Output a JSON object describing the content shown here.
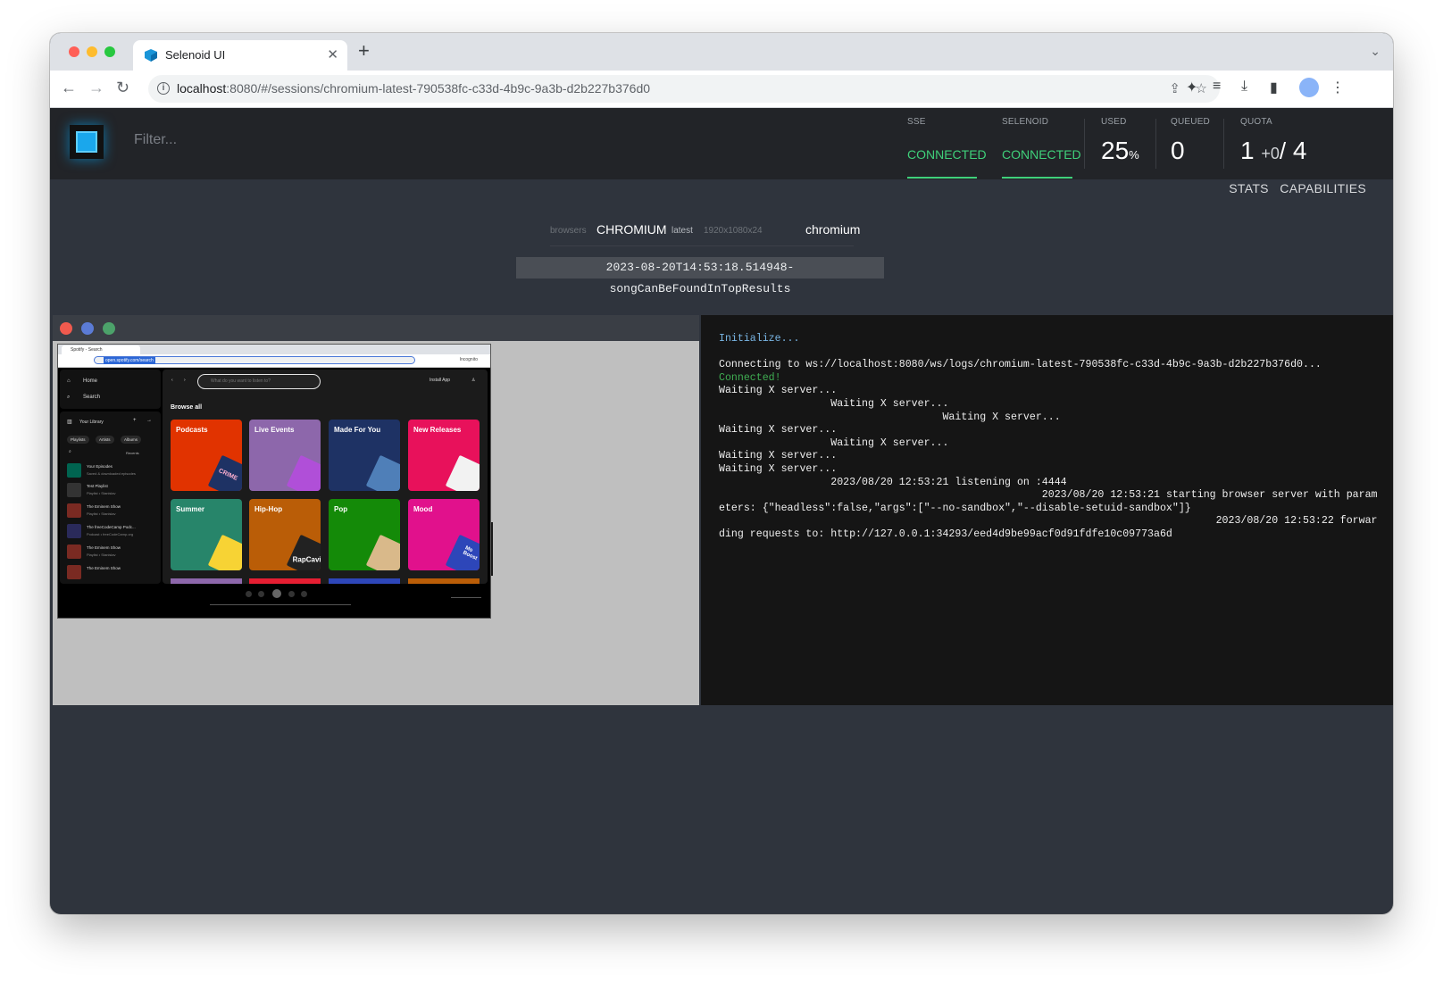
{
  "browser": {
    "tab_title": "Selenoid UI",
    "url_host": "localhost",
    "url_rest": ":8080/#/sessions/chromium-latest-790538fc-c33d-4b9c-9a3b-d2b227b376d0"
  },
  "header": {
    "filter_placeholder": "Filter...",
    "sse_label": "SSE",
    "sse_status": "CONNECTED",
    "selenoid_label": "SELENOID",
    "selenoid_status": "CONNECTED",
    "used_label": "USED",
    "used_value": "25",
    "used_unit": "%",
    "queued_label": "QUEUED",
    "queued_value": "0",
    "quota_label": "QUOTA",
    "quota_used": "1",
    "quota_plus": "+",
    "quota_queued": "0",
    "quota_slash": "/",
    "quota_total": "4"
  },
  "subnav": {
    "stats": "STATS",
    "capabilities": "CAPABILITIES"
  },
  "session": {
    "browsers_label": "browsers",
    "browser_name": "CHROMIUM",
    "version": "latest",
    "resolution": "1920x1080x24",
    "name": "chromium",
    "test_name": "2023-08-20T14:53:18.514948-songCanBeFoundInTopResults"
  },
  "vnc": {
    "tab_title": "Spotify - Search",
    "url": "open.spotify.com/search",
    "incognito": "Incognito",
    "sidebar": {
      "home": "Home",
      "search": "Search",
      "library": "Your Library",
      "chips": [
        "Playlists",
        "Artists",
        "Albums"
      ],
      "recents": "Recents",
      "items": [
        {
          "title": "Your Episodes",
          "sub": "Saved & downloaded episodes"
        },
        {
          "title": "Test Playlist",
          "sub": "Playlist • Stanislav"
        },
        {
          "title": "The Eminem Show",
          "sub": "Playlist • Stanislav"
        },
        {
          "title": "The freeCodeCamp Podc...",
          "sub": "Podcast • freeCodeCamp.org"
        },
        {
          "title": "The Eminem Show",
          "sub": "Playlist • Stanislav"
        },
        {
          "title": "The Eminem Show",
          "sub": ""
        }
      ]
    },
    "search_placeholder": "What do you want to listen to?",
    "install_app": "Install App",
    "browse_all": "Browse all",
    "cards": [
      {
        "label": "Podcasts",
        "color": "#e13300",
        "art": "#1e3264"
      },
      {
        "label": "Live Events",
        "color": "#8d67ab",
        "art": "#b04fd8"
      },
      {
        "label": "Made For You",
        "color": "#1e3264",
        "art": "#4f7fb8"
      },
      {
        "label": "New Releases",
        "color": "#e8115b",
        "art": "#f2f2f2"
      },
      {
        "label": "Summer",
        "color": "#27856a",
        "art": "#f7d334"
      },
      {
        "label": "Hip-Hop",
        "color": "#ba5d07",
        "art": "#222222"
      },
      {
        "label": "Pop",
        "color": "#148a08",
        "art": "#d9b98a"
      },
      {
        "label": "Mood",
        "color": "#e1118c",
        "art": "#2d46b9"
      }
    ],
    "art_text": {
      "podcasts": "CRIME",
      "hiphop": "RapCavi",
      "mood": "Mo Boost"
    }
  },
  "log": {
    "init": "Initialize...",
    "connecting": "Connecting to ws://localhost:8080/ws/logs/chromium-latest-790538fc-c33d-4b9c-9a3b-d2b227b376d0...",
    "connected": "Connected!",
    "lines": "Waiting X server...\n                  Waiting X server...\n                                    Waiting X server...\nWaiting X server...\n                  Waiting X server...\nWaiting X server...\nWaiting X server...\n                  2023/08/20 12:53:21 listening on :4444\n                                                    2023/08/20 12:53:21 starting browser server with parameters: {\"headless\":false,\"args\":[\"--no-sandbox\",\"--disable-setuid-sandbox\"]}\n                                                                                2023/08/20 12:53:22 forwarding requests to: http://127.0.0.1:34293/eed4d9be99acf0d91fdfe10c09773a6d"
  },
  "colors": {
    "connected": "#3fd07a",
    "accent": "#1aa7ec",
    "header_bg": "#222428",
    "page_bg": "#2f343d"
  }
}
